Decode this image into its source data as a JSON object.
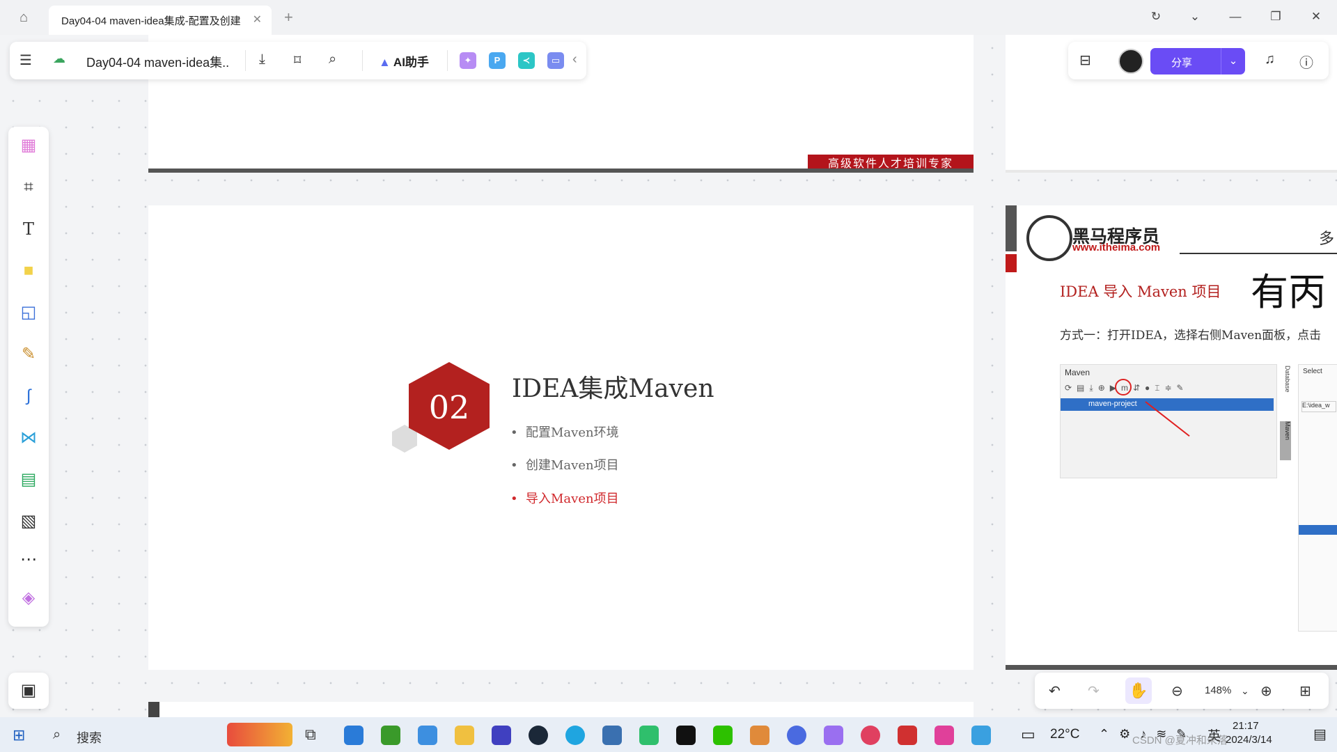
{
  "browser": {
    "tab_title": "Day04-04 maven-idea集成-配置及创建",
    "home_icon": "home-icon",
    "close_icon": "close-icon",
    "new_tab_symbol": "+"
  },
  "toolbar": {
    "doc_title": "Day04-04 maven-idea集..",
    "ai_label": "AI助手"
  },
  "rightbar": {
    "share_label": "分享"
  },
  "zoom": {
    "value": "148%"
  },
  "slide_top": {
    "banner": "高级软件人才培训专家"
  },
  "slide_main": {
    "number": "02",
    "title": "IDEA集成Maven",
    "bullets": [
      {
        "text": "配置Maven环境",
        "active": false
      },
      {
        "text": "创建Maven项目",
        "active": false
      },
      {
        "text": "导入Maven项目",
        "active": true
      }
    ]
  },
  "slide_right": {
    "logo_title": "黑马程序员",
    "logo_url": "www.itheima.com",
    "more": "多",
    "heading": "IDEA 导入 Maven 项目",
    "method_text": "方式一：打开IDEA，选择右侧Maven面板，点击",
    "panel_label": "Maven",
    "project_row": "maven-project",
    "side_label_1": "Database",
    "side_label_2": "Maven",
    "select_label": "Select",
    "path_label": "E:\\idea_w"
  },
  "taskbar": {
    "search_label": "搜索",
    "temperature": "22°C",
    "ime": "英",
    "time": "21:17",
    "date": "2024/3/14",
    "watermark": "CSDN @夏冲和朱落"
  },
  "colors": {
    "accent": "#6a4cf5",
    "slide_red": "#b3211f",
    "active_bullet": "#d0282c"
  }
}
